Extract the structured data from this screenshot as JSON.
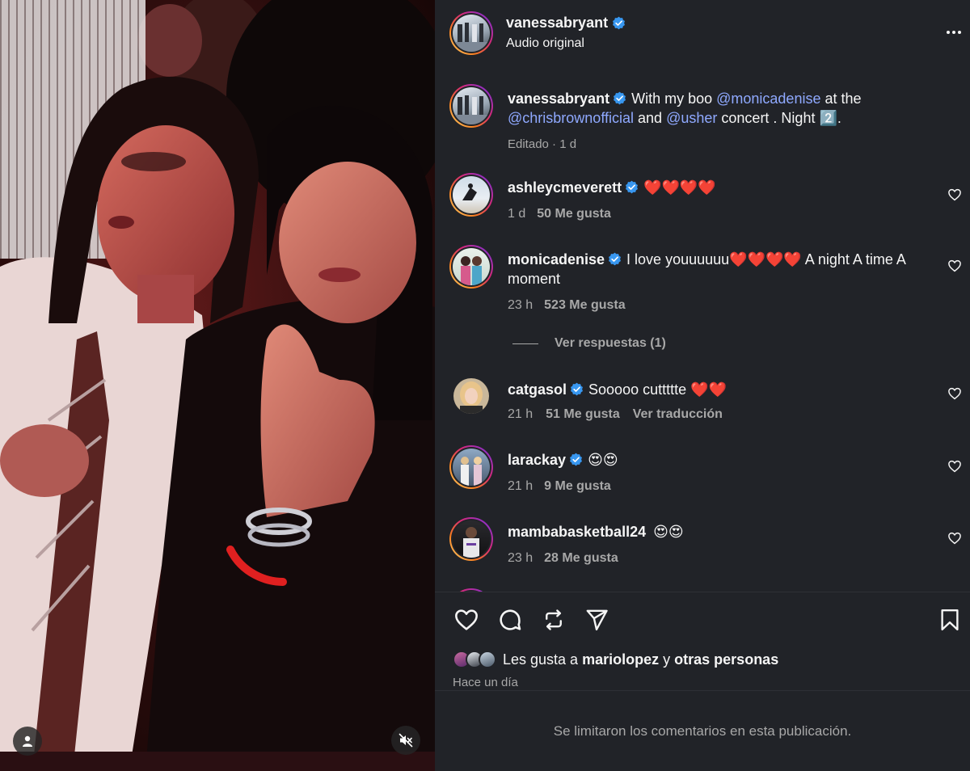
{
  "media": {
    "user_tag_icon": "user-icon",
    "mute_icon": "speaker-muted-icon"
  },
  "post": {
    "author": "vanessabryant",
    "audio": "Audio original",
    "more_icon": "more-horizontal-icon",
    "caption": {
      "author": "vanessabryant",
      "text_1": "With my boo",
      "mention_1": "@monicadenise",
      "text_2": "at the",
      "mention_2": "@chrisbrownofficial",
      "text_3": "and",
      "mention_3": "@usher",
      "text_4": "concert . Night 2️⃣.",
      "meta": "Editado · 1 d"
    }
  },
  "comments": [
    {
      "user": "ashleycmeverett",
      "text": "❤️❤️❤️❤️",
      "time": "1 d",
      "likes": "50 Me gusta",
      "extra": ""
    },
    {
      "user": "monicadenise",
      "text": "I love youuuuuu❤️❤️❤️❤️ A night A time A moment",
      "time": "23 h",
      "likes": "523 Me gusta",
      "extra": "",
      "replies": "Ver respuestas (1)"
    },
    {
      "user": "catgasol",
      "text": "Sooooo cuttttte ❤️❤️",
      "time": "21 h",
      "likes": "51 Me gusta",
      "extra": "Ver traducción"
    },
    {
      "user": "larackay",
      "text": "😍😍",
      "time": "21 h",
      "likes": "9 Me gusta",
      "extra": ""
    },
    {
      "user": "mambabasketball24",
      "text": "😍😍",
      "time": "23 h",
      "likes": "28 Me gusta",
      "extra": ""
    }
  ],
  "actions": {
    "like_icon": "heart-icon",
    "comment_icon": "comment-icon",
    "repost_icon": "repost-icon",
    "share_icon": "send-icon",
    "save_icon": "bookmark-icon"
  },
  "likes": {
    "prefix": "Les gusta a",
    "user": "mariolopez",
    "connector": "y",
    "others": "otras personas",
    "when": "Hace un día"
  },
  "footer": {
    "notice": "Se limitaron los comentarios en esta publicación."
  },
  "colors": {
    "panel_bg": "#212328",
    "mention": "#8fa9ff",
    "verified": "#3897f0",
    "muted_text": "#a8a8a8"
  }
}
